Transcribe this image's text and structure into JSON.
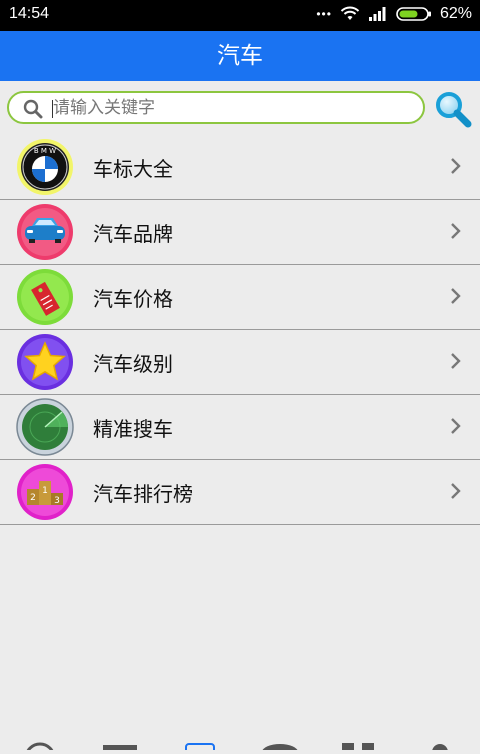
{
  "status": {
    "time": "14:54",
    "dots": "•••",
    "battery": "62%"
  },
  "title": "汽车",
  "search": {
    "placeholder": "请输入关键字"
  },
  "items": [
    {
      "label": "车标大全",
      "icon": "bmw-logo-icon"
    },
    {
      "label": "汽车品牌",
      "icon": "car-icon"
    },
    {
      "label": "汽车价格",
      "icon": "price-tag-icon"
    },
    {
      "label": "汽车级别",
      "icon": "star-icon"
    },
    {
      "label": "精准搜车",
      "icon": "radar-icon"
    },
    {
      "label": "汽车排行榜",
      "icon": "podium-icon"
    }
  ],
  "colors": {
    "titlebar": "#1a73f2",
    "search_border": "#8cc63f",
    "background": "#ececec"
  }
}
